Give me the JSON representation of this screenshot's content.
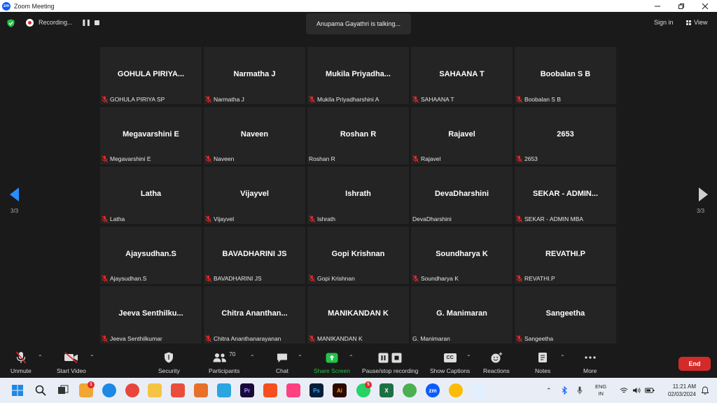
{
  "window": {
    "title": "Zoom Meeting"
  },
  "topbar": {
    "recording_label": "Recording...",
    "talking_text": "Anupama Gayathri is talking...",
    "sign_in": "Sign in",
    "view": "View"
  },
  "gallery": {
    "page_indicator": "3/3",
    "tiles": [
      {
        "name": "GOHULA PIRIYA...",
        "label": "GOHULA PIRIYA SP",
        "muted": true
      },
      {
        "name": "Narmatha J",
        "label": "Narmatha J",
        "muted": true
      },
      {
        "name": "Mukila  Priyadha...",
        "label": "Mukila Priyadharshini A",
        "muted": true
      },
      {
        "name": "SAHAANA T",
        "label": "SAHAANA T",
        "muted": true
      },
      {
        "name": "Boobalan S B",
        "label": "Boobalan S B",
        "muted": true
      },
      {
        "name": "Megavarshini E",
        "label": "Megavarshini E",
        "muted": true
      },
      {
        "name": "Naveen",
        "label": "Naveen",
        "muted": true
      },
      {
        "name": "Roshan R",
        "label": "Roshan R",
        "muted": false
      },
      {
        "name": "Rajavel",
        "label": "Rajavel",
        "muted": true
      },
      {
        "name": "2653",
        "label": "2653",
        "muted": true
      },
      {
        "name": "Latha",
        "label": "Latha",
        "muted": true
      },
      {
        "name": "Vijayvel",
        "label": "Vijayvel",
        "muted": true
      },
      {
        "name": "Ishrath",
        "label": "Ishrath",
        "muted": true
      },
      {
        "name": "DevaDharshini",
        "label": "DevaDharshini",
        "muted": false
      },
      {
        "name": "SEKAR - ADMIN...",
        "label": "SEKAR - ADMIN MBA",
        "muted": true
      },
      {
        "name": "Ajaysudhan.S",
        "label": "Ajaysudhan.S",
        "muted": true
      },
      {
        "name": "BAVADHARINI JS",
        "label": "BAVADHARINI JS",
        "muted": true
      },
      {
        "name": "Gopi Krishnan",
        "label": "Gopi Krishnan",
        "muted": true
      },
      {
        "name": "Soundharya K",
        "label": "Soundharya K",
        "muted": true
      },
      {
        "name": "REVATHI.P",
        "label": "REVATHI.P",
        "muted": true
      },
      {
        "name": "Jeeva  Senthilku...",
        "label": "Jeeva Senthilkumar",
        "muted": true
      },
      {
        "name": "Chitra  Ananthan...",
        "label": "Chitra Ananthanarayanan",
        "muted": true
      },
      {
        "name": "MANIKANDAN K",
        "label": "MANIKANDAN K",
        "muted": true
      },
      {
        "name": "G. Manimaran",
        "label": "G. Manimaran",
        "muted": false
      },
      {
        "name": "Sangeetha",
        "label": "Sangeetha",
        "muted": true
      }
    ]
  },
  "toolbar": {
    "unmute": "Unmute",
    "start_video": "Start Video",
    "security": "Security",
    "participants": "Participants",
    "participants_count": "70",
    "chat": "Chat",
    "share_screen": "Share Screen",
    "pause_stop_recording": "Pause/stop recording",
    "show_captions": "Show Captions",
    "captions_icon_text": "CC",
    "reactions": "Reactions",
    "notes": "Notes",
    "more": "More",
    "end": "End"
  },
  "taskbar": {
    "chrome_badge": "1",
    "whatsapp_badge": "5",
    "language_top": "ENG",
    "language_bottom": "IN",
    "time": "11:21 AM",
    "date": "02/03/2024",
    "icons": [
      {
        "name": "windows-start-icon",
        "label": ""
      },
      {
        "name": "search-icon",
        "label": ""
      },
      {
        "name": "task-view-icon",
        "label": ""
      },
      {
        "name": "chrome-badge-icon",
        "label": ""
      },
      {
        "name": "edge-icon",
        "label": ""
      },
      {
        "name": "chrome-icon",
        "label": ""
      },
      {
        "name": "file-explorer-icon",
        "label": ""
      },
      {
        "name": "paint-icon",
        "label": ""
      },
      {
        "name": "recycle-icon",
        "label": ""
      },
      {
        "name": "screen-tool-icon",
        "label": ""
      },
      {
        "name": "premiere-icon",
        "label": "Pr"
      },
      {
        "name": "arrow-app-icon",
        "label": ""
      },
      {
        "name": "color-app-icon",
        "label": ""
      },
      {
        "name": "photoshop-icon",
        "label": "Ps"
      },
      {
        "name": "illustrator-icon",
        "label": "Ai"
      },
      {
        "name": "whatsapp-icon",
        "label": ""
      },
      {
        "name": "excel-icon",
        "label": "X"
      },
      {
        "name": "chrome-profile-icon",
        "label": ""
      },
      {
        "name": "zoom-taskbar-icon",
        "label": "zm"
      },
      {
        "name": "chrome-alt-icon",
        "label": ""
      },
      {
        "name": "snipping-tool-icon",
        "label": ""
      }
    ]
  },
  "colors": {
    "zoom_blue": "#0b5cff",
    "end_red": "#d42a2a",
    "share_green": "#22c34a",
    "mic_muted_red": "#e02828"
  }
}
